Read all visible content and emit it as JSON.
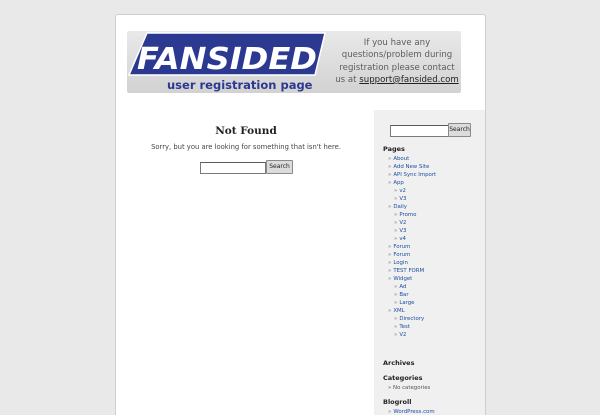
{
  "banner": {
    "logo_text": "FANSIDED",
    "logo_subtitle": "user registration page",
    "contact_lines": [
      "If you have any",
      "questions/problem during",
      "registration please contact"
    ],
    "contact_prefix": "us at ",
    "contact_email": "support@fansided.com"
  },
  "main": {
    "title": "Not Found",
    "message": "Sorry, but you are looking for something that isn't here.",
    "search_value": "",
    "search_button": "Search"
  },
  "sidebar": {
    "search_value": "",
    "search_button": "Search",
    "pages_heading": "Pages",
    "pages": [
      {
        "label": "About",
        "level": 0
      },
      {
        "label": "Add New Site",
        "level": 0
      },
      {
        "label": "API Sync Import",
        "level": 0
      },
      {
        "label": "App",
        "level": 0
      },
      {
        "label": "v2",
        "level": 1
      },
      {
        "label": "V3",
        "level": 1
      },
      {
        "label": "Daily",
        "level": 0
      },
      {
        "label": "Promo",
        "level": 1
      },
      {
        "label": "V2",
        "level": 1
      },
      {
        "label": "V3",
        "level": 1
      },
      {
        "label": "v4",
        "level": 1
      },
      {
        "label": "Forum",
        "level": 0
      },
      {
        "label": "Forum",
        "level": 0
      },
      {
        "label": "Login",
        "level": 0
      },
      {
        "label": "TEST FORM",
        "level": 0
      },
      {
        "label": "Widget",
        "level": 0
      },
      {
        "label": "Ad",
        "level": 1
      },
      {
        "label": "Bar",
        "level": 1
      },
      {
        "label": "Large",
        "level": 1
      },
      {
        "label": "XML",
        "level": 0
      },
      {
        "label": "Directory",
        "level": 1
      },
      {
        "label": "Test",
        "level": 1
      },
      {
        "label": "V2",
        "level": 1
      }
    ],
    "archives_heading": "Archives",
    "categories_heading": "Categories",
    "categories_empty": "No categories",
    "blogroll_heading": "Blogroll",
    "blogroll": [
      {
        "label": "WordPress.com"
      }
    ]
  },
  "colors": {
    "background": "#e9e9e9",
    "link": "#1a4ea0",
    "logo_blue": "#2c3990",
    "sidebar_bg": "#f0f0f0"
  }
}
